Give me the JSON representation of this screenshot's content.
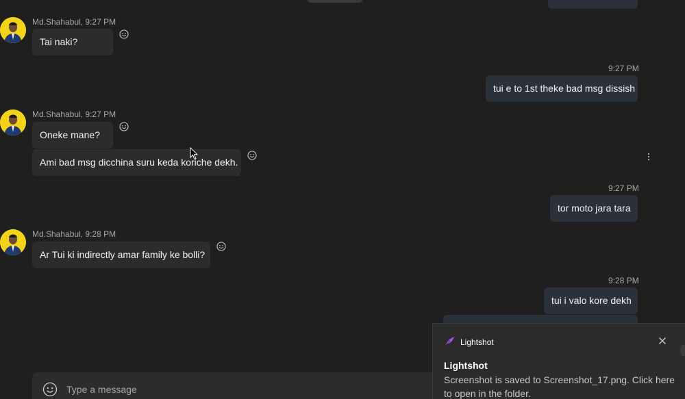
{
  "messages": {
    "m1": {
      "sender": "Md.Shahabul, 9:27 PM",
      "text": "Tai naki?"
    },
    "m2": {
      "time": "9:27 PM",
      "text": "tui e to 1st theke bad msg dissish"
    },
    "m3": {
      "sender": "Md.Shahabul, 9:27 PM",
      "text": "Oneke mane?"
    },
    "m4": {
      "text": "Ami bad msg dicchina suru keda koriche dekh."
    },
    "m5": {
      "time": "9:27 PM",
      "text": "tor moto jara tara"
    },
    "m6": {
      "sender": "Md.Shahabul, 9:28 PM",
      "text": "Ar Tui ki indirectly amar family ke bolli?"
    },
    "m7": {
      "time": "9:28 PM",
      "text": "tui i valo kore dekh"
    }
  },
  "compose": {
    "placeholder": "Type a message"
  },
  "toast": {
    "app_name": "Lightshot",
    "title": "Lightshot",
    "body": "Screenshot is saved to Screenshot_17.png. Click here to open in the folder."
  },
  "colors": {
    "background": "#1f1f1f",
    "incoming_bubble": "#2c2c2c",
    "outgoing_bubble": "#2b3138",
    "avatar_bg": "#f3d41a",
    "lightshot_accent": "#a855f7"
  },
  "icons": {
    "reaction": "smiley-icon",
    "more": "more-options-icon",
    "emoji": "emoji-icon",
    "close": "close-icon",
    "logo": "lightshot-feather-icon"
  }
}
